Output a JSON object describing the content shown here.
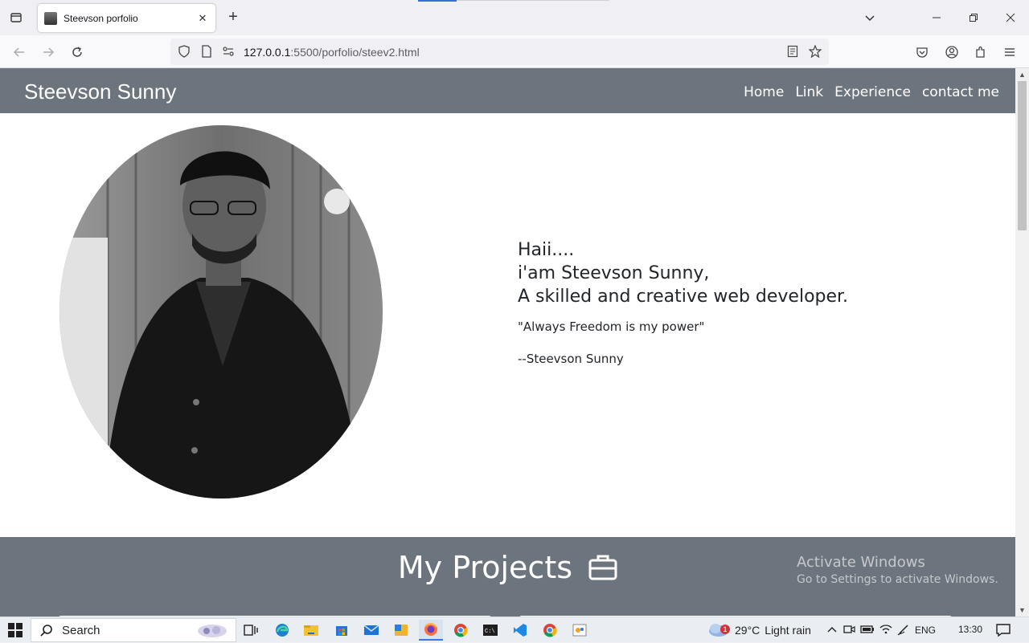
{
  "browser": {
    "tab_title": "Steevson porfolio",
    "url_host": "127.0.0.1",
    "url_rest": ":5500/porfolio/steev2.html"
  },
  "site": {
    "brand": "Steevson Sunny",
    "nav": [
      "Home",
      "Link",
      "Experience",
      "contact me"
    ]
  },
  "intro": {
    "line1": "Haii....",
    "line2": "i'am Steevson Sunny,",
    "line3": "A skilled and creative web developer.",
    "quote": "\"Always Freedom is my power\"",
    "author": "--Steevson Sunny"
  },
  "projects": {
    "heading": "My Projects"
  },
  "watermark": {
    "line1": "Activate Windows",
    "line2": "Go to Settings to activate Windows."
  },
  "taskbar": {
    "search_label": "Search",
    "weather_temp": "29°C",
    "weather_desc": "Light rain",
    "weather_badge": "1",
    "language": "ENG",
    "time": "13:30"
  }
}
